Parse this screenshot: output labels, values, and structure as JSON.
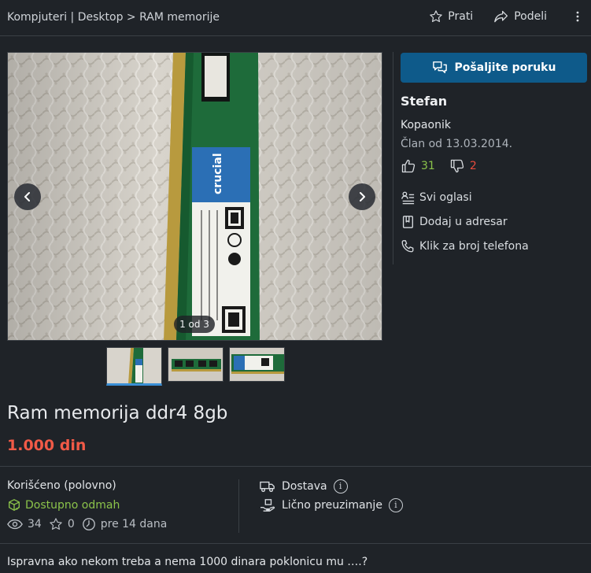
{
  "breadcrumb": {
    "category": "Kompjuteri",
    "separator": "|",
    "subcategory": "Desktop",
    "arrow": ">",
    "current": "RAM memorije"
  },
  "top_actions": {
    "follow": "Prati",
    "share": "Podeli"
  },
  "gallery": {
    "counter": "1 od 3",
    "image_count": 3,
    "current_index": 1
  },
  "seller": {
    "message_button": "Pošaljite poruku",
    "name": "Stefan",
    "location": "Kopaonik",
    "member_since": "Član od 13.03.2014.",
    "positive": "31",
    "negative": "2",
    "links": {
      "all_ads": "Svi oglasi",
      "add_address": "Dodaj u adresar",
      "phone": "Klik za broj telefona"
    }
  },
  "listing": {
    "title": "Ram memorija ddr4 8gb",
    "price": "1.000 din",
    "condition": "Korišćeno (polovno)",
    "availability": "Dostupno odmah",
    "views": "34",
    "favorites": "0",
    "posted": "pre 14 dana",
    "delivery": "Dostava",
    "pickup": "Lično preuzimanje",
    "description": "Ispravna ako nekom treba a nema 1000 dinara poklonicu mu ….?"
  },
  "colors": {
    "background": "#1f2328",
    "accent_blue": "#0e5a8a",
    "price_red": "#f15a47",
    "positive_green": "#8bc34a",
    "negative_red": "#e84b3c"
  },
  "icons": [
    "star-icon",
    "share-arrow-icon",
    "kebab-menu-icon",
    "chevron-left-icon",
    "chevron-right-icon",
    "chat-icon",
    "thumbs-up-icon",
    "thumbs-down-icon",
    "list-user-icon",
    "address-book-icon",
    "phone-icon",
    "box-check-icon",
    "eye-icon",
    "star-outline-icon",
    "clock-icon",
    "truck-icon",
    "hand-package-icon",
    "info-icon"
  ]
}
